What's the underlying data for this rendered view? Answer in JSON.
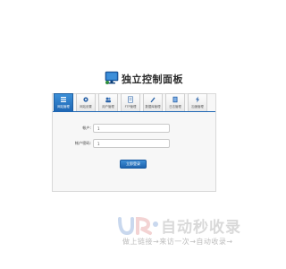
{
  "brand": {
    "title": "独立控制面板"
  },
  "tabs": [
    {
      "label": "网站管理",
      "icon": "list-icon",
      "active": true
    },
    {
      "label": "网站设置",
      "icon": "gear-icon",
      "active": false
    },
    {
      "label": "用户管理",
      "icon": "users-icon",
      "active": false
    },
    {
      "label": "FTP管理",
      "icon": "document-icon",
      "active": false
    },
    {
      "label": "数据库管理",
      "icon": "pen-icon",
      "active": false
    },
    {
      "label": "日志管理",
      "icon": "book-icon",
      "active": false
    },
    {
      "label": "加速管理",
      "icon": "lightning-icon",
      "active": false
    }
  ],
  "form": {
    "account_label": "帐户:",
    "account_value": "1",
    "password_label": "帐户密码:",
    "password_value": "1",
    "login_label": "立即登录"
  },
  "watermark": {
    "title": "自动秒收录",
    "slogan": "做上链接→来访一次→自动收录→"
  },
  "colors": {
    "accent": "#1f67b4",
    "text": "#2a2a2a"
  }
}
